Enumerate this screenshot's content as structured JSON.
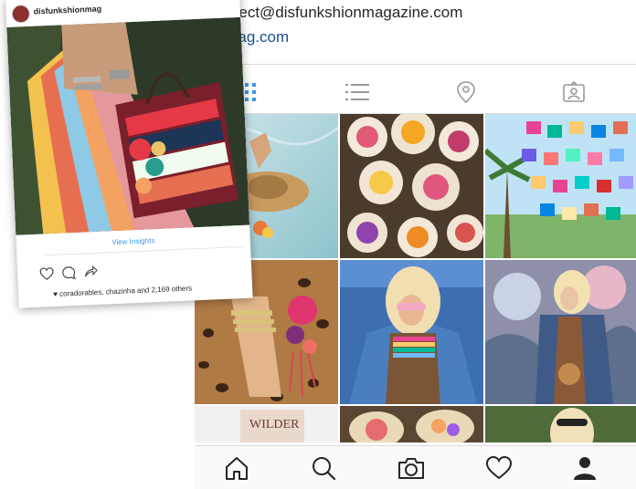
{
  "profile": {
    "email": "onnect@disfunkshionmagazine.com",
    "website": "fsmag.com",
    "view_tabs": [
      {
        "name": "grid-view-icon",
        "active": true
      },
      {
        "name": "list-view-icon",
        "active": false
      },
      {
        "name": "map-pin-icon",
        "active": false
      },
      {
        "name": "tagged-photos-icon",
        "active": false
      }
    ],
    "grid_tiles": [
      "pool hat photo",
      "flower bouquets",
      "colorful papel picado flags",
      "leopard dress with bracelets and flowers",
      "blonde woman in denim jacket",
      "woman by mural",
      "magazine cover",
      "flower bowls",
      "sunglasses portrait"
    ],
    "magazine_text": "WILDER"
  },
  "post": {
    "username": "disfunkshionmag",
    "view_insights": "View Insights",
    "likes_text": "coradorables, chazinha and 2,169 others"
  },
  "tabbar": [
    {
      "name": "home-icon"
    },
    {
      "name": "search-icon"
    },
    {
      "name": "camera-icon"
    },
    {
      "name": "heart-icon"
    },
    {
      "name": "profile-icon"
    }
  ],
  "colors": {
    "link_blue": "#1b4f8f",
    "insights_blue": "#3897f0",
    "active_tab_blue": "#3897f0",
    "inactive_icon": "#999999",
    "divider": "#dbdbdb"
  }
}
